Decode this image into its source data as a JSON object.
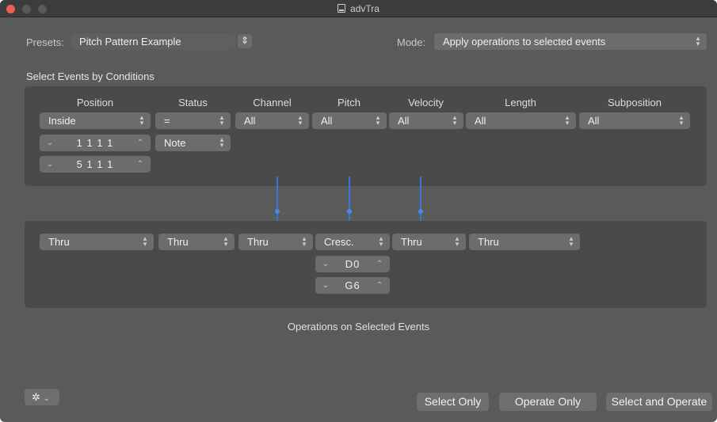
{
  "window": {
    "title": "advTra"
  },
  "presets": {
    "label": "Presets:",
    "value": "Pitch Pattern Example"
  },
  "mode": {
    "label": "Mode:",
    "value": "Apply operations to selected events"
  },
  "conditions": {
    "section_label": "Select Events by Conditions",
    "headers": {
      "position": "Position",
      "status": "Status",
      "channel": "Channel",
      "pitch": "Pitch",
      "velocity": "Velocity",
      "length": "Length",
      "subposition": "Subposition"
    },
    "values": {
      "position": "Inside",
      "status": "=",
      "channel": "All",
      "pitch": "All",
      "velocity": "All",
      "length": "All",
      "subposition": "All"
    },
    "position_start": "1 1 1    1",
    "position_end": "5 1 1    1",
    "status_type": "Note"
  },
  "operations": {
    "section_label": "Operations on Selected Events",
    "values": {
      "position": "Thru",
      "status": "Thru",
      "channel": "Thru",
      "pitch": "Cresc.",
      "velocity": "Thru",
      "length": "Thru"
    },
    "pitch_from": "D0",
    "pitch_to": "G6"
  },
  "buttons": {
    "select_only": "Select Only",
    "operate_only": "Operate Only",
    "select_and_operate": "Select and Operate"
  },
  "colors": {
    "window_bg": "#5a5a5a",
    "panel_bg": "#4a4a4a",
    "control_bg": "#6c6c6c",
    "accent": "#3b74d9",
    "close": "#ec5f57"
  }
}
